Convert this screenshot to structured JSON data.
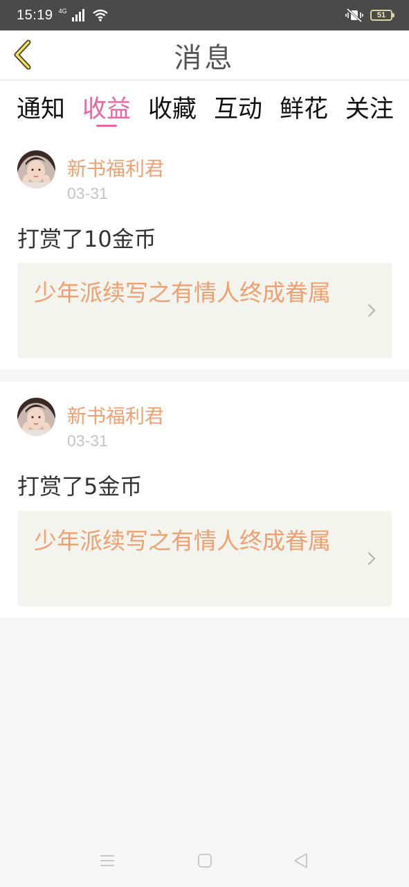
{
  "status_bar": {
    "time": "15:19",
    "network": "4G",
    "battery": "51"
  },
  "header": {
    "title": "消息"
  },
  "tabs": [
    {
      "label": "通知",
      "active": false
    },
    {
      "label": "收益",
      "active": true
    },
    {
      "label": "收藏",
      "active": false
    },
    {
      "label": "互动",
      "active": false
    },
    {
      "label": "鲜花",
      "active": false
    },
    {
      "label": "关注",
      "active": false
    }
  ],
  "messages": [
    {
      "sender": "新书福利君",
      "date": "03-31",
      "text": "打赏了10金币",
      "book_title": "少年派续写之有情人终成眷属"
    },
    {
      "sender": "新书福利君",
      "date": "03-31",
      "text": "打赏了5金币",
      "book_title": "少年派续写之有情人终成眷属"
    }
  ],
  "colors": {
    "accent": "#e966a3",
    "sender": "#f0a070",
    "status_bar": "#4a4a4a",
    "back_arrow": "#f4e04a"
  },
  "icons": {
    "back": "chevron-left-icon",
    "chevron": "chevron-right-icon",
    "nav_menu": "menu-icon",
    "nav_home": "home-icon",
    "nav_back": "back-triangle-icon"
  }
}
